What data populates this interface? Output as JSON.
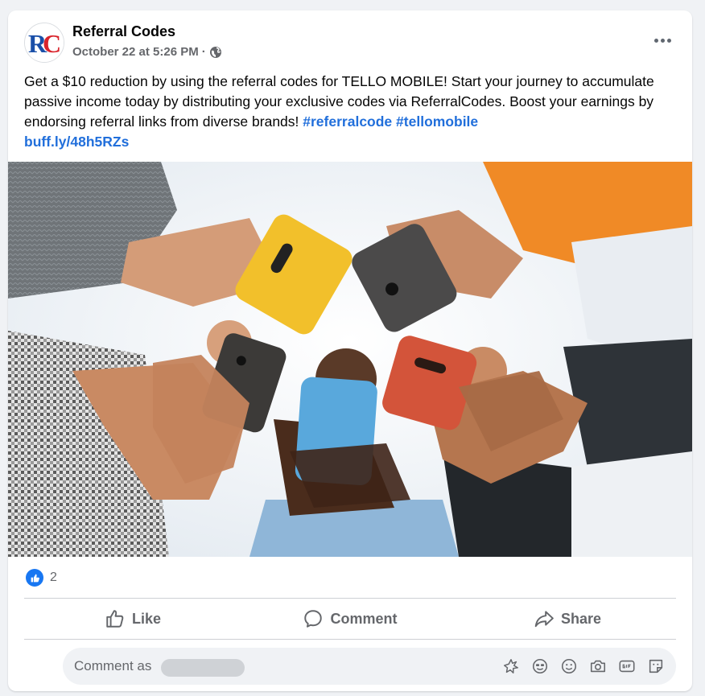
{
  "post": {
    "page_name": "Referral Codes",
    "timestamp": "October 22 at 5:26 PM",
    "separator": "·",
    "privacy_icon": "globe-icon",
    "text": "Get a $10 reduction by using the referral codes for TELLO MOBILE! Start your journey to accumulate passive income today by distributing your exclusive codes via ReferralCodes. Boost your earnings by endorsing referral links from diverse brands! ",
    "hashtags": [
      "#referralcode",
      "#tellomobile"
    ],
    "link": "buff.ly/48h5RZs",
    "avatar_text": "RC"
  },
  "reactions": {
    "icon": "like-reaction-icon",
    "count": "2"
  },
  "actions": {
    "like_label": "Like",
    "comment_label": "Comment",
    "share_label": "Share"
  },
  "composer": {
    "placeholder": "Comment as",
    "icons": [
      "avatar-sticker-icon",
      "emoji-smile-icon",
      "emoji-icon",
      "camera-icon",
      "gif-icon",
      "sticker-icon"
    ]
  },
  "colors": {
    "accent": "#1877f2",
    "link": "#216fdb",
    "secondary_text": "#65676b",
    "background": "#f0f2f5"
  }
}
